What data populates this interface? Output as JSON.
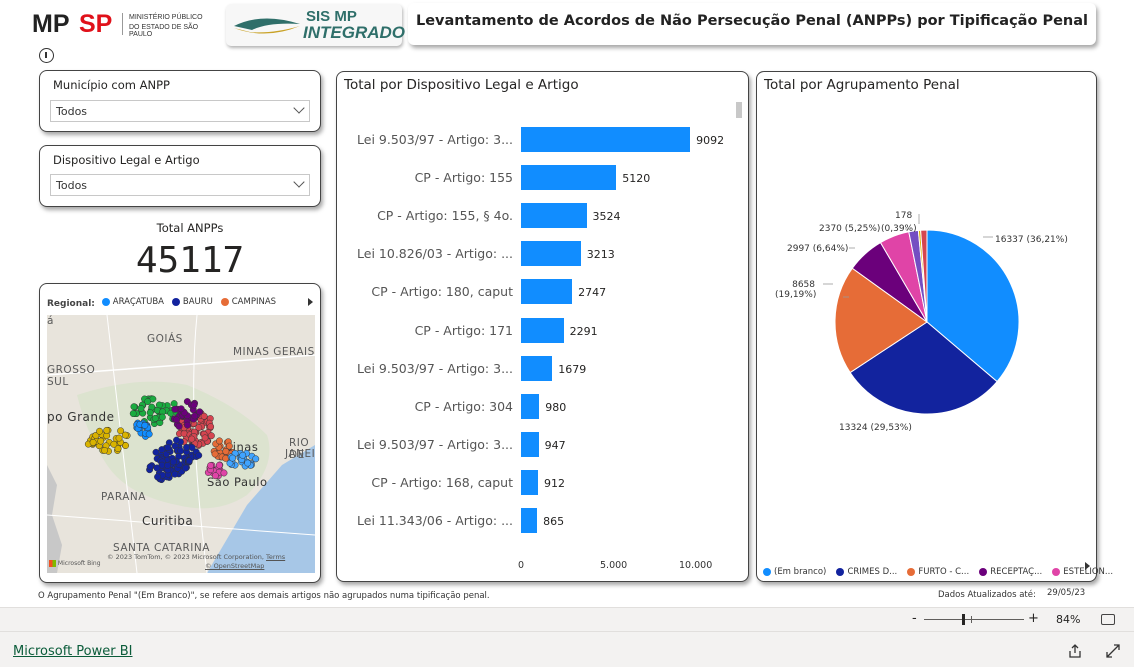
{
  "header": {
    "logo_mp": "MP",
    "logo_sp": "SP",
    "logo_sub_line1": "MINISTÉRIO PÚBLICO",
    "logo_sub_line2": "DO ESTADO DE SÃO PAULO",
    "sis_line1": "SIS MP",
    "sis_line2": "INTEGRADO",
    "title": "Levantamento de Acordos de Não Persecução Penal (ANPPs) por Tipificação Penal"
  },
  "filters": {
    "municipio_label": "Município com ANPP",
    "municipio_value": "Todos",
    "dispositivo_label": "Dispositivo Legal e Artigo",
    "dispositivo_value": "Todos"
  },
  "kpi": {
    "label": "Total ANPPs",
    "value": "45117"
  },
  "map": {
    "legend_title": "Regional:",
    "legend": [
      {
        "name": "ARAÇATUBA",
        "color": "#118dff"
      },
      {
        "name": "BAURU",
        "color": "#12239e"
      },
      {
        "name": "CAMPINAS",
        "color": "#e66c37"
      }
    ],
    "labels": {
      "goias": "GOIÁS",
      "minas": "MINAS GERAIS",
      "grosso1": "GROSSO",
      "grosso2": "SUL",
      "grande": "po Grande",
      "parana": "PARANA",
      "curitiba": "Curitiba",
      "santa": "SANTA CATARINA",
      "sp": "São Paulo",
      "rio1": "RIO DE",
      "rio2": "JANEIRO",
      "campinas": "pinas",
      "topa": "á"
    },
    "attribution": "© 2023 TomTom, © 2023 Microsoft Corporation,",
    "terms": "Terms",
    "osm": "© OpenStreetMap",
    "bing": "Microsoft Bing"
  },
  "chart_data": [
    {
      "type": "bar",
      "title": "Total por Dispositivo Legal e Artigo",
      "categories": [
        "Lei 9.503/97 - Artigo: 3...",
        "CP - Artigo: 155",
        "CP - Artigo: 155, § 4o.",
        "Lei 10.826/03 - Artigo: ...",
        "CP - Artigo: 180, caput",
        "CP - Artigo: 171",
        "Lei 9.503/97 - Artigo: 3...",
        "CP - Artigo: 304",
        "Lei 9.503/97 - Artigo: 3...",
        "CP - Artigo: 168, caput",
        "Lei 11.343/06 - Artigo: ..."
      ],
      "values": [
        9092,
        5120,
        3524,
        3213,
        2747,
        2291,
        1679,
        980,
        947,
        912,
        865
      ],
      "xticks": [
        "0",
        "5.000",
        "10.000"
      ],
      "xlim": [
        0,
        10000
      ],
      "color": "#118dff"
    },
    {
      "type": "pie",
      "title": "Total por Agrupamento Penal",
      "slices": [
        {
          "name": "(Em branco)",
          "value": 16337,
          "label": "16337 (36,21%)",
          "color": "#118dff"
        },
        {
          "name": "CRIMES D...",
          "value": 13324,
          "label": "13324 (29,53%)",
          "color": "#12239e"
        },
        {
          "name": "FURTO - C...",
          "value": 8658,
          "label": "8658 (19,19%)",
          "color": "#e66c37"
        },
        {
          "name": "RECEPTAÇ...",
          "value": 2997,
          "label": "2997 (6,64%)",
          "color": "#6b007b"
        },
        {
          "name": "ESTELION...",
          "value": 2370,
          "label": "2370 (5,25%)",
          "color": "#e044a7"
        },
        {
          "name": "",
          "value": 755,
          "label": "",
          "color": "#744ec2"
        },
        {
          "name": "",
          "value": 178,
          "label": "178",
          "color": "#d9b300"
        },
        {
          "name": "",
          "value": 498,
          "label": "",
          "color": "#d64550"
        }
      ],
      "extra_label": "(0,39%)"
    }
  ],
  "footer": {
    "note": "O Agrupamento Penal \"(Em Branco)\", se refere aos demais artigos não agrupados numa tipificação penal.",
    "updated_label": "Dados Atualizados até:",
    "updated_value": "29/05/23"
  },
  "statusbar": {
    "zoom_minus": "-",
    "zoom_plus": "+",
    "zoom": "84%",
    "brand": "Microsoft Power BI"
  }
}
